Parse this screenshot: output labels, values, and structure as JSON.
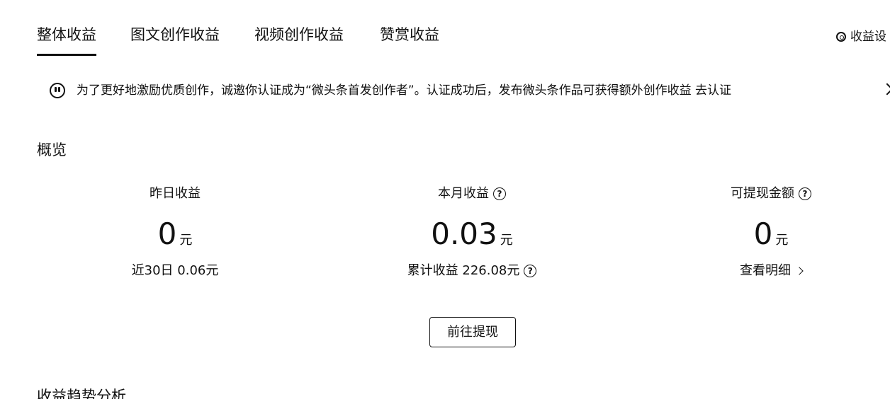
{
  "tabs": [
    {
      "label": "整体收益"
    },
    {
      "label": "图文创作收益"
    },
    {
      "label": "视频创作收益"
    },
    {
      "label": "赞赏收益"
    }
  ],
  "settings": {
    "label": "收益设"
  },
  "notice": {
    "text": "为了更好地激励优质创作，诚邀你认证成为“微头条首发创作者”。认证成功后，发布微头条作品可获得额外创作收益",
    "link": "去认证"
  },
  "overview": {
    "title": "概览",
    "yesterday": {
      "label": "昨日收益",
      "value": "0",
      "unit": "元",
      "sub": "近30日 0.06元"
    },
    "month": {
      "label": "本月收益",
      "value": "0.03",
      "unit": "元",
      "sub": "累计收益 226.08元"
    },
    "withdrawable": {
      "label": "可提现金额",
      "value": "0",
      "unit": "元",
      "sub": "查看明细"
    }
  },
  "withdraw_button": "前往提现",
  "trend_title": "收益趋势分析"
}
